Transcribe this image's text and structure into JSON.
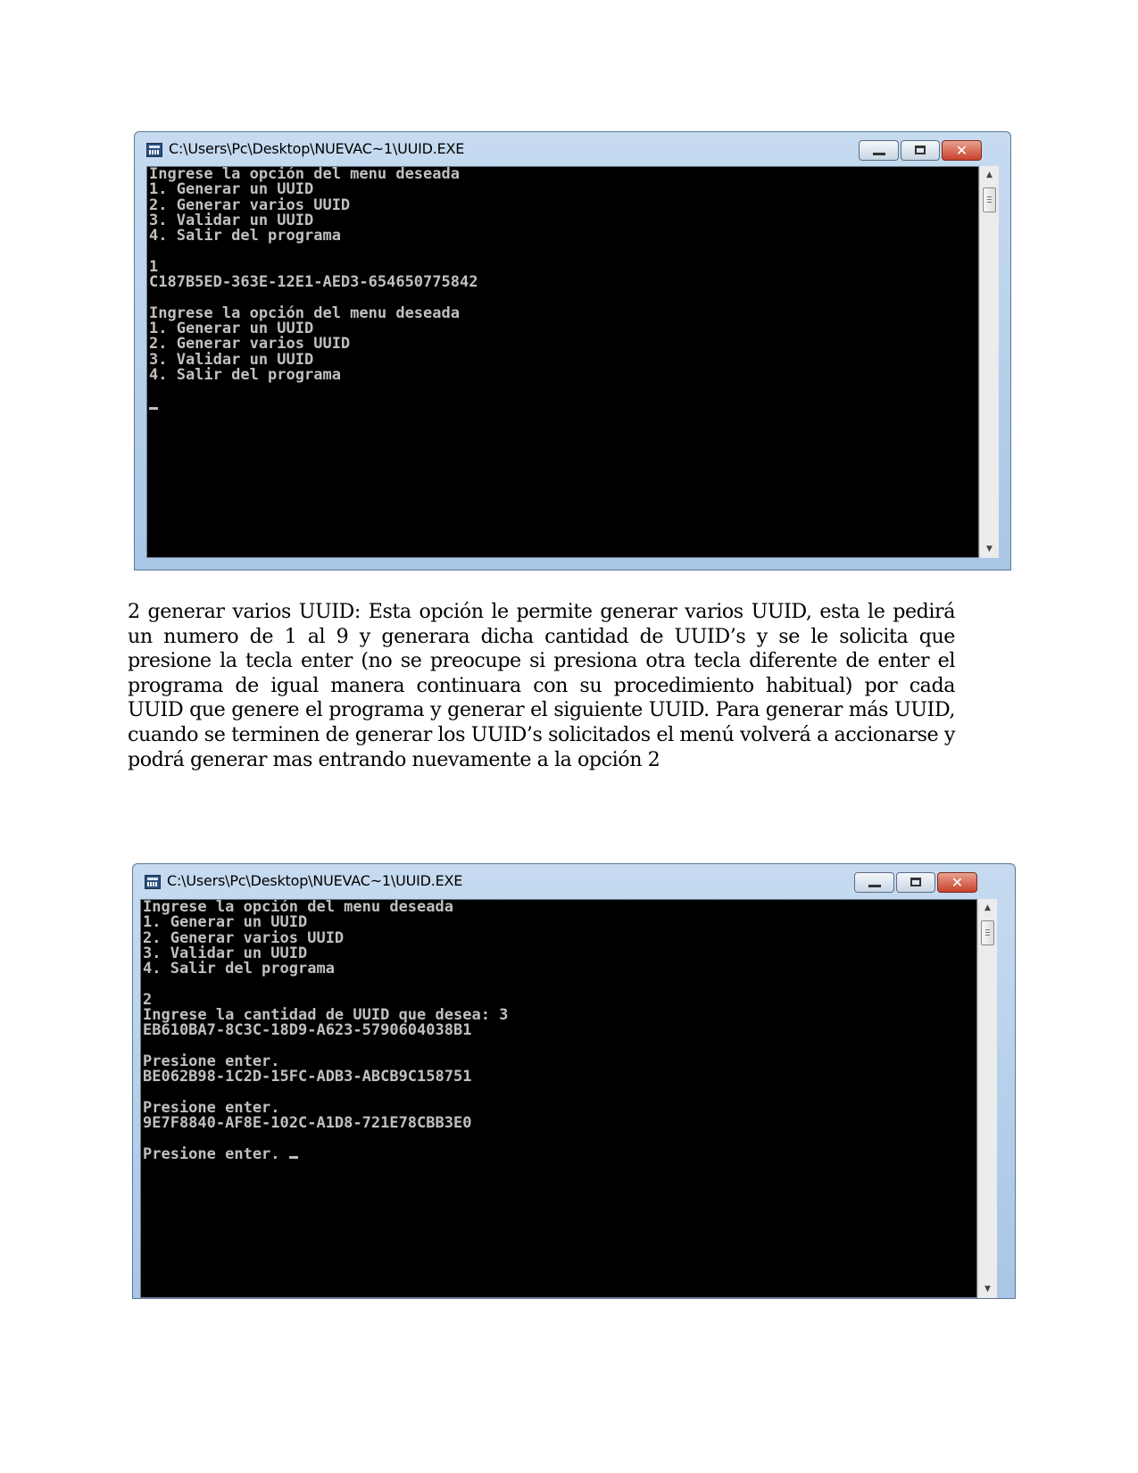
{
  "window1": {
    "title": "C:\\Users\\Pc\\Desktop\\NUEVAC~1\\UUID.EXE",
    "console_text": "Ingrese la opción del menu deseada\n1. Generar un UUID\n2. Generar varios UUID\n3. Validar un UUID\n4. Salir del programa\n\n1\nC187B5ED-363E-12E1-AED3-654650775842\n\nIngrese la opción del menu deseada\n1. Generar un UUID\n2. Generar varios UUID\n3. Validar un UUID\n4. Salir del programa\n\n"
  },
  "paragraph": "2 generar varios UUID: Esta opción le permite generar varios UUID, esta le pedirá un numero de 1 al 9 y generara dicha cantidad de UUID’s y se le solicita que presione la tecla enter (no se preocupe si presiona otra tecla diferente de enter el programa de igual manera continuara con su procedimiento habitual) por cada UUID que genere el programa y generar el siguiente UUID. Para generar más UUID, cuando se terminen de generar los UUID’s solicitados el menú volverá a accionarse y podrá generar mas entrando nuevamente a la opción 2",
  "window2": {
    "title": "C:\\Users\\Pc\\Desktop\\NUEVAC~1\\UUID.EXE",
    "console_text": "Ingrese la opción del menu deseada\n1. Generar un UUID\n2. Generar varios UUID\n3. Validar un UUID\n4. Salir del programa\n\n2\nIngrese la cantidad de UUID que desea: 3\nEB610BA7-8C3C-18D9-A623-5790604038B1\n\nPresione enter.\nBE062B98-1C2D-15FC-ADB3-ABCB9C158751\n\nPresione enter.\n9E7F8840-AF8E-102C-A1D8-721E78CBB3E0\n\nPresione enter. "
  }
}
